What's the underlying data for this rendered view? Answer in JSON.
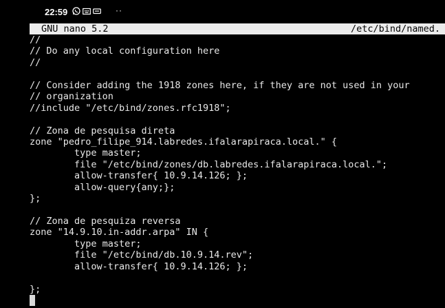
{
  "status_bar": {
    "time": "22:59",
    "icons": [
      "whatsapp-icon",
      "keyboard-icon",
      "keyboard-small-icon"
    ],
    "overflow": "··"
  },
  "nano": {
    "app_label": "GNU nano 5.2",
    "filename": "/etc/bind/named."
  },
  "editor": {
    "lines": [
      "//",
      "// Do any local configuration here",
      "//",
      "",
      "// Consider adding the 1918 zones here, if they are not used in your",
      "// organization",
      "//include \"/etc/bind/zones.rfc1918\";",
      "",
      "// Zona de pesquisa direta",
      "zone \"pedro_filipe_914.labredes.ifalarapiraca.local.\" {",
      "        type master;",
      "        file \"/etc/bind/zones/db.labredes.ifalarapiraca.local.\";",
      "        allow-transfer{ 10.9.14.126; };",
      "        allow-query{any;};",
      "};",
      "",
      "// Zona de pesquiza reversa",
      "zone \"14.9.10.in-addr.arpa\" IN {",
      "        type master;",
      "        file \"/etc/bind/db.10.9.14.rev\";",
      "        allow-transfer{ 10.9.14.126; };",
      "",
      "};",
      ""
    ]
  }
}
